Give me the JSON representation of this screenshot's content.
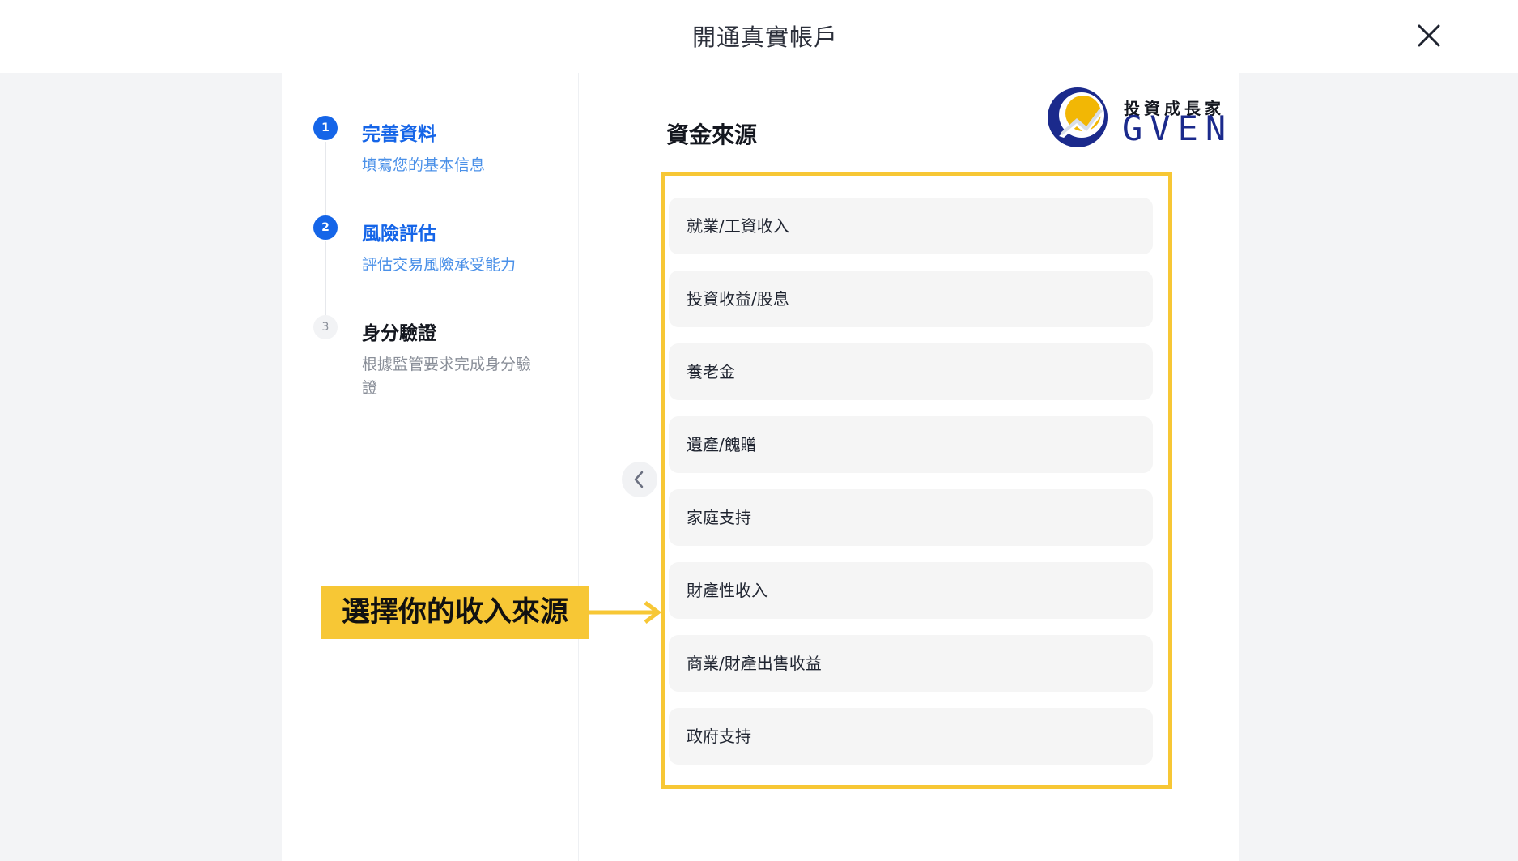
{
  "header": {
    "title": "開通真實帳戶",
    "close_icon": "close-icon"
  },
  "stepper": {
    "steps": [
      {
        "number": "1",
        "title": "完善資料",
        "description": "填寫您的基本信息",
        "state": "active"
      },
      {
        "number": "2",
        "title": "風險評估",
        "description": "評估交易風險承受能力",
        "state": "active"
      },
      {
        "number": "3",
        "title": "身分驗證",
        "description": "根據監管要求完成身分驗證",
        "state": "inactive"
      }
    ]
  },
  "form": {
    "section_title": "資金來源",
    "back_icon": "chevron-left-icon",
    "options": [
      "就業/工資收入",
      "投資收益/股息",
      "養老金",
      "遺產/餽贈",
      "家庭支持",
      "財產性收入",
      "商業/財產出售收益",
      "政府支持"
    ]
  },
  "logo": {
    "chinese_text": "投資成長家",
    "english_text": "GVEN"
  },
  "annotation": {
    "callout_text": "選擇你的收入來源"
  },
  "colors": {
    "primary": "#1565E8",
    "primary_light": "#4A90E8",
    "highlight": "#F7C735",
    "option_bg": "#F5F5F5",
    "page_bg": "#F3F4F6",
    "logo_navy": "#1B2A8C",
    "logo_gold": "#F2B705"
  }
}
